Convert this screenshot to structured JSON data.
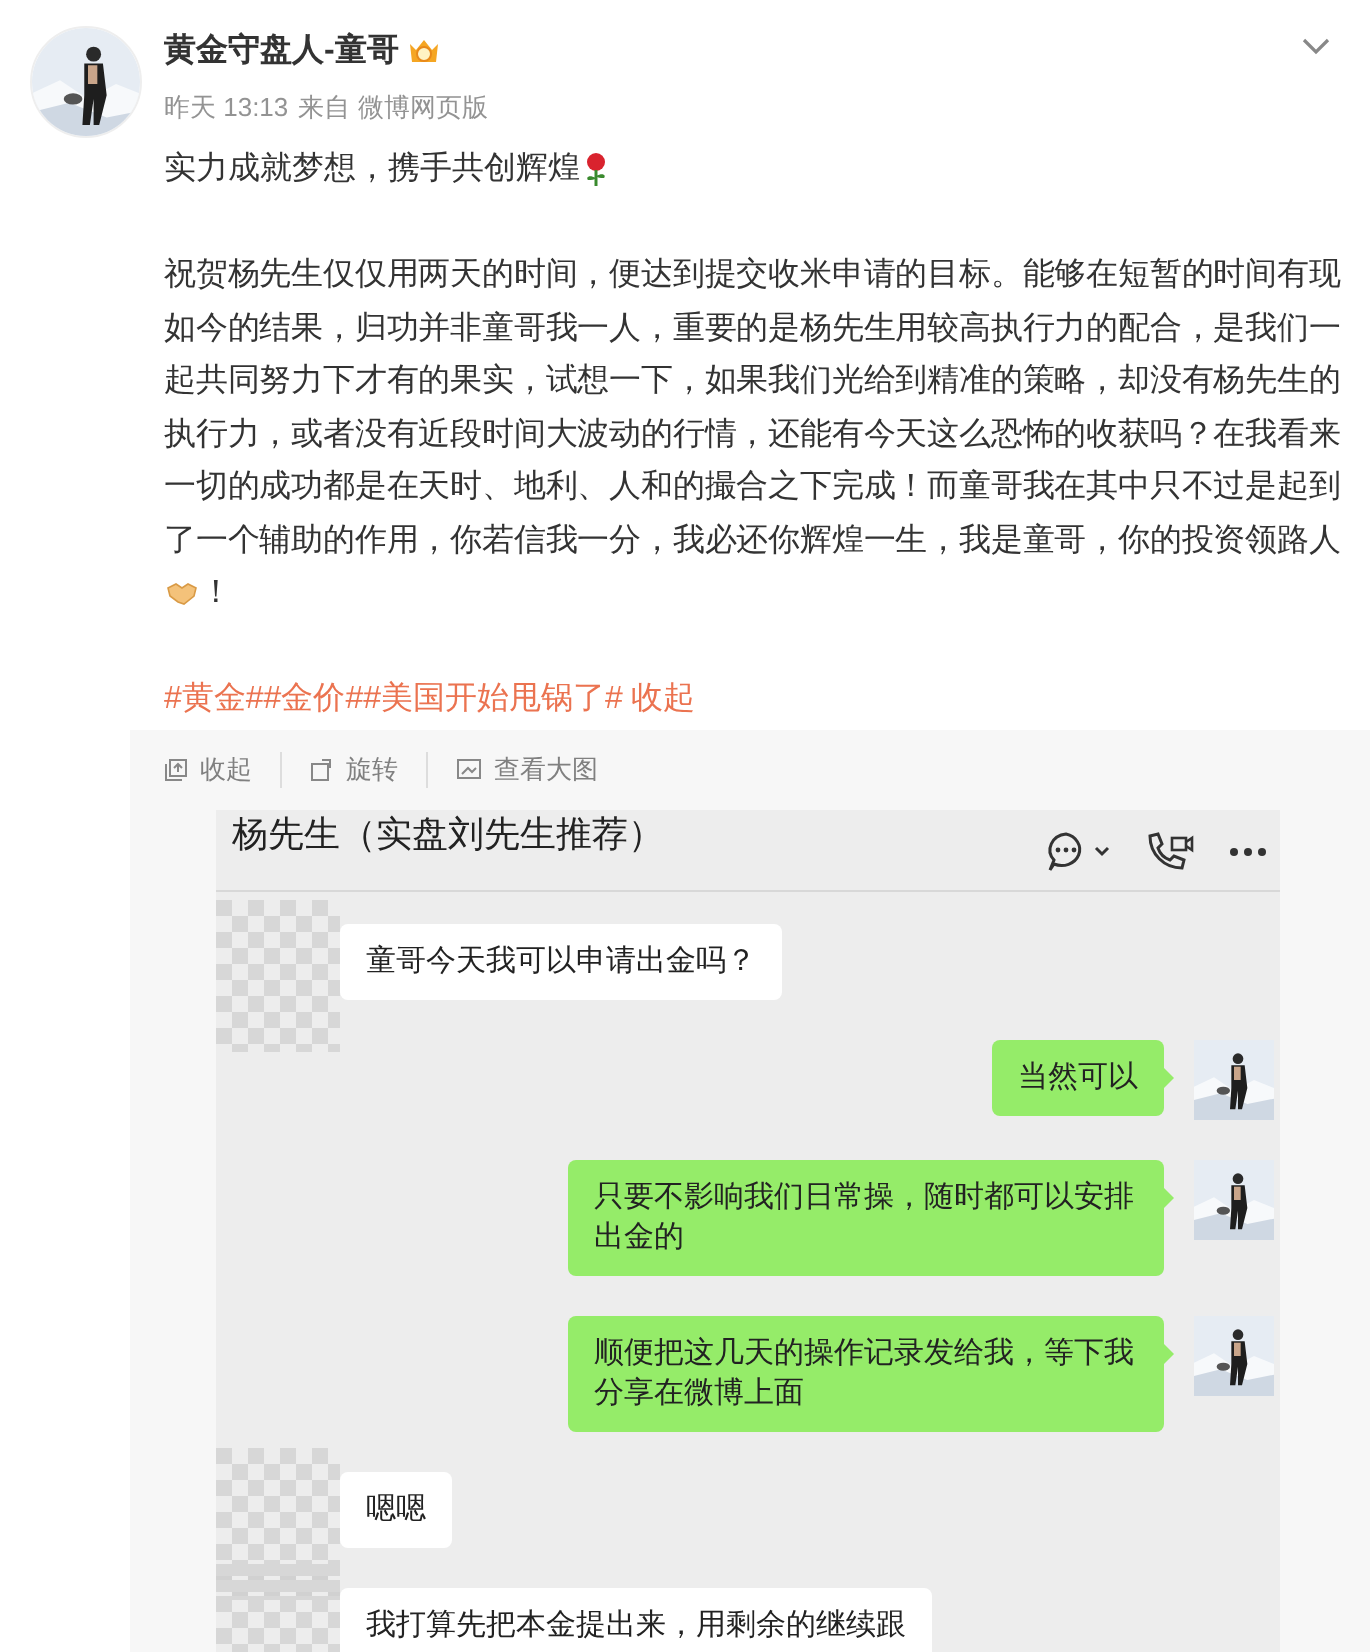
{
  "post": {
    "author": "黄金守盘人-童哥",
    "time": "昨天 13:13",
    "source": "来自 微博网页版",
    "headline": "实力成就梦想，携手共创辉煌",
    "body_before_icon": "祝贺杨先生仅仅用两天的时间，便达到提交收米申请的目标。能够在短暂的时间有现如今的结果，归功并非童哥我一人，重要的是杨先生用较高执行力的配合，是我们一起共同努力下才有的果实，试想一下，如果我们光给到精准的策略，却没有杨先生的执行力，或者没有近段时间大波动的行情，还能有今天这么恐怖的收获吗？在我看来一切的成功都是在天时、地利、人和的撮合之下完成！而童哥我在其中只不过是起到了一个辅助的作用，你若信我一分，我必还你辉煌一生，我是童哥，你的投资领路人",
    "body_after_icon": "！",
    "hashtags": [
      "#黄金#",
      "#金价#",
      "#美国开始甩锅了#"
    ],
    "collapse_link": "收起"
  },
  "image_toolbar": [
    "收起",
    "旋转",
    "查看大图"
  ],
  "chat": {
    "title": "杨先生（实盘刘先生推荐）",
    "messages": [
      {
        "kind": "received",
        "text": "童哥今天我可以申请出金吗？"
      },
      {
        "kind": "sent",
        "text": "当然可以"
      },
      {
        "kind": "sent",
        "text": "只要不影响我们日常操，随时都可以安排出金的"
      },
      {
        "kind": "sent",
        "text": "顺便把这几天的操作记录发给我，等下我分享在微博上面"
      },
      {
        "kind": "received",
        "text": "嗯嗯"
      },
      {
        "kind": "received",
        "text": "我打算先把本金提出来，用剩余的继续跟"
      }
    ]
  }
}
